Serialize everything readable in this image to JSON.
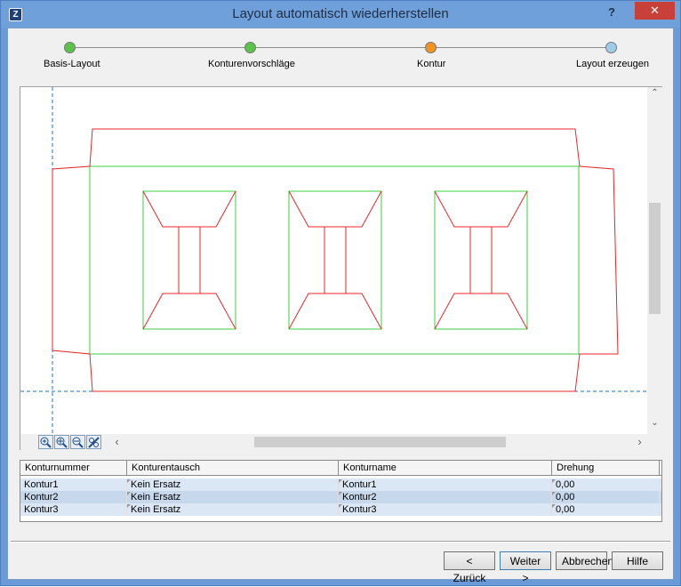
{
  "window": {
    "title": "Layout automatisch wiederherstellen",
    "help_glyph": "?",
    "close_glyph": "✕",
    "app_icon_glyph": "Z"
  },
  "stepper": {
    "steps": [
      {
        "label": "Basis-Layout",
        "state": "done",
        "color": "#5cc34a"
      },
      {
        "label": "Konturenvorschläge",
        "state": "done",
        "color": "#5cc34a"
      },
      {
        "label": "Kontur",
        "state": "current",
        "color": "#f39320"
      },
      {
        "label": "Layout erzeugen",
        "state": "pending",
        "color": "#9fcde8"
      }
    ]
  },
  "canvas": {
    "outline_color": "#e8262a",
    "fold_color": "#3ccf3c",
    "guide_color": "#1a76c8",
    "scroll_up": "⌃",
    "scroll_down": "⌄",
    "scroll_left": "‹",
    "scroll_right": "›",
    "zoom_tools": [
      "zoom-fit-icon",
      "zoom-in-icon",
      "zoom-out-icon",
      "pan-icon"
    ]
  },
  "table": {
    "headers": [
      "Konturnummer",
      "Konturentausch",
      "Konturname",
      "Drehung"
    ],
    "rows": [
      {
        "nummer": "Kontur1",
        "tausch": "Kein Ersatz",
        "name": "Kontur1",
        "drehung": "0,00"
      },
      {
        "nummer": "Kontur2",
        "tausch": "Kein Ersatz",
        "name": "Kontur2",
        "drehung": "0,00"
      },
      {
        "nummer": "Kontur3",
        "tausch": "Kein Ersatz",
        "name": "Kontur3",
        "drehung": "0,00"
      }
    ]
  },
  "buttons": {
    "back": "< Zurück",
    "next": "Weiter >",
    "cancel": "Abbrechen",
    "help": "Hilfe"
  }
}
